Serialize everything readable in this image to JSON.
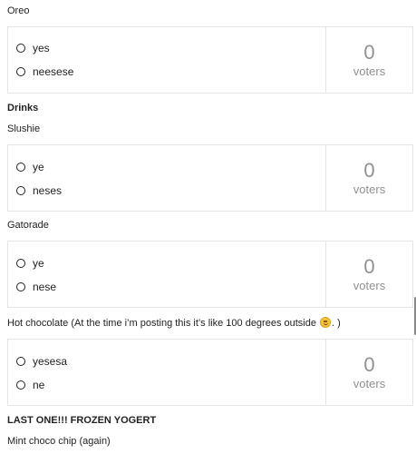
{
  "sections": {
    "oreo_title": "Oreo",
    "drinks_heading": "Drinks",
    "slushie_title": "Slushie",
    "gatorade_title": "Gatorade",
    "hotchoc_title_pre": "Hot chocolate (At the time i’m posting this it’s like 100 degrees outside ",
    "hotchoc_emoji": "slightly-smiling-face-icon",
    "hotchoc_title_post": ". )",
    "frozen_heading": "LAST ONE!!! FROZEN YOGERT",
    "mint_title": "Mint choco chip (again)"
  },
  "polls": {
    "oreo": {
      "options": [
        "yes",
        "neesese"
      ],
      "count": "0",
      "count_label": "voters"
    },
    "slushie": {
      "options": [
        "ye",
        "neses"
      ],
      "count": "0",
      "count_label": "voters"
    },
    "gatorade": {
      "options": [
        "ye",
        "nese"
      ],
      "count": "0",
      "count_label": "voters"
    },
    "hotchoc": {
      "options": [
        "yesesa",
        "ne"
      ],
      "count": "0",
      "count_label": "voters"
    }
  }
}
